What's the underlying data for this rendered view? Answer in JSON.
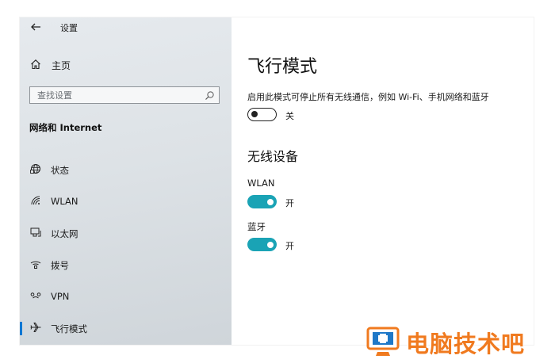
{
  "window": {
    "title": "设置",
    "back_icon": "arrow-left-icon"
  },
  "sidebar": {
    "home_label": "主页",
    "search_placeholder": "查找设置",
    "section_heading": "网络和 Internet",
    "items": [
      {
        "label": "状态",
        "icon": "globe-status-icon",
        "active": false
      },
      {
        "label": "WLAN",
        "icon": "wifi-icon",
        "active": false
      },
      {
        "label": "以太网",
        "icon": "ethernet-icon",
        "active": false
      },
      {
        "label": "拨号",
        "icon": "dialup-icon",
        "active": false
      },
      {
        "label": "VPN",
        "icon": "vpn-icon",
        "active": false
      },
      {
        "label": "飞行模式",
        "icon": "airplane-icon",
        "active": true
      }
    ]
  },
  "content": {
    "title": "飞行模式",
    "description": "启用此模式可停止所有无线通信，例如 Wi-Fi、手机网络和蓝牙",
    "airplane_state": "关",
    "wireless_heading": "无线设备",
    "wlan_label": "WLAN",
    "wlan_state": "开",
    "bluetooth_label": "蓝牙",
    "bluetooth_state": "开"
  },
  "watermark": {
    "text": "电脑技术吧"
  },
  "colors": {
    "toggle_on": "#1aa3b5",
    "accent": "#0078d4",
    "watermark": "#f07a1f"
  }
}
